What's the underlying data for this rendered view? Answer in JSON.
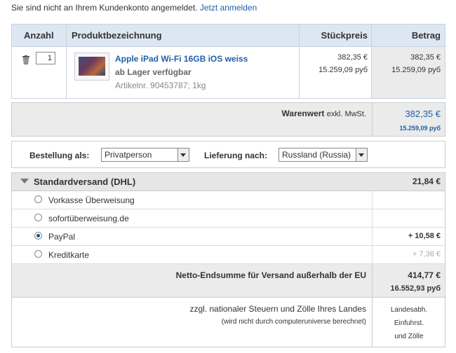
{
  "login": {
    "message": "Sie sind nicht an Ihrem Kundenkonto angemeldet.",
    "link": "Jetzt anmelden"
  },
  "cart": {
    "headers": {
      "anzahl": "Anzahl",
      "produkt": "Produktbezeichnung",
      "stueckpreis": "Stückpreis",
      "betrag": "Betrag"
    },
    "item": {
      "quantity": "1",
      "name": "Apple iPad Wi-Fi 16GB iOS weiss",
      "availability": "ab Lager verfügbar",
      "article": "Artikelnr. 90453787; 1kg",
      "unit_price_eur": "382,35 €",
      "unit_price_rub": "15.259,09 руб",
      "total_eur": "382,35 €",
      "total_rub": "15.259,09 руб"
    }
  },
  "warenwert": {
    "label": "Warenwert",
    "label_suffix": "exkl. MwSt.",
    "value_eur": "382,35 €",
    "value_rub": "15.259,09 руб"
  },
  "options": {
    "bestellung_label": "Bestellung als:",
    "bestellung_value": "Privatperson",
    "lieferung_label": "Lieferung nach:",
    "lieferung_value": "Russland (Russia)"
  },
  "shipping": {
    "title": "Standardversand (DHL)",
    "price": "21,84 €",
    "payments": [
      {
        "label": "Vorkasse Überweisung",
        "price": "",
        "selected": false
      },
      {
        "label": "sofortüberweisung.de",
        "price": "",
        "selected": false
      },
      {
        "label": "PayPal",
        "price": "+ 10,58 €",
        "selected": true
      },
      {
        "label": "Kreditkarte",
        "price": "+ 7,36 €",
        "selected": false
      }
    ],
    "netto_label": "Netto-Endsumme für Versand außerhalb der EU",
    "netto_eur": "414,77 €",
    "netto_rub": "16.552,93 руб",
    "tax_label": "zzgl. nationaler Steuern und Zölle Ihres Landes",
    "tax_sub": "(wird nicht durch computeruniverse berechnet)",
    "tax_note": [
      "Landesabh.",
      "Einfuhrst.",
      "und Zölle"
    ]
  }
}
